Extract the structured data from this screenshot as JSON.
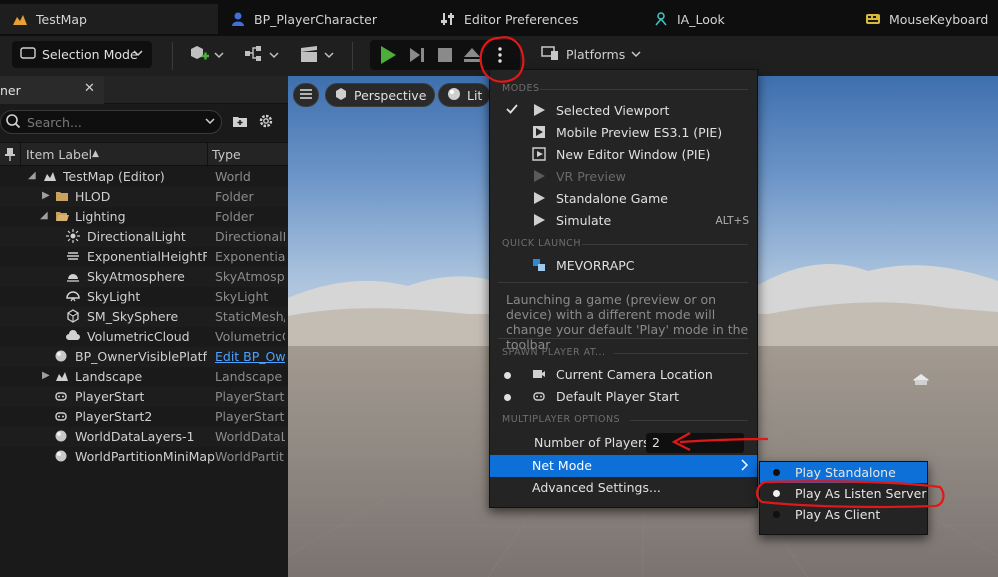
{
  "tabs": [
    {
      "label": "TestMap",
      "icon": "level-icon"
    },
    {
      "label": "BP_PlayerCharacter",
      "icon": "blueprint-icon"
    },
    {
      "label": "Editor Preferences",
      "icon": "sliders-icon"
    },
    {
      "label": "IA_Look",
      "icon": "input-action-icon"
    },
    {
      "label": "MouseKeyboard",
      "icon": "mapping-icon"
    }
  ],
  "toolbar": {
    "selection_mode": "Selection Mode",
    "platforms": "Platforms"
  },
  "outliner": {
    "title": "ner",
    "search_placeholder": "Search...",
    "col_label": "Item Label",
    "col_label_sort": "▲",
    "col_type": "Type",
    "rows": [
      {
        "label": "TestMap (Editor)",
        "type": "World"
      },
      {
        "label": "HLOD",
        "type": "Folder"
      },
      {
        "label": "Lighting",
        "type": "Folder"
      },
      {
        "label": "DirectionalLight",
        "type": "DirectionalL"
      },
      {
        "label": "ExponentialHeightFog",
        "type": "ExponentialI"
      },
      {
        "label": "SkyAtmosphere",
        "type": "SkyAtmospl"
      },
      {
        "label": "SkyLight",
        "type": "SkyLight"
      },
      {
        "label": "SM_SkySphere",
        "type": "StaticMesh/"
      },
      {
        "label": "VolumetricCloud",
        "type": "VolumetricC"
      },
      {
        "label": "BP_OwnerVisiblePlatfo",
        "type": "Edit BP_Ow"
      },
      {
        "label": "Landscape",
        "type": "Landscape"
      },
      {
        "label": "PlayerStart",
        "type": "PlayerStart"
      },
      {
        "label": "PlayerStart2",
        "type": "PlayerStart"
      },
      {
        "label": "WorldDataLayers-1",
        "type": "WorldDataL"
      },
      {
        "label": "WorldPartitionMiniMap",
        "type": "WorldPartiti"
      }
    ]
  },
  "viewport": {
    "perspective": "Perspective",
    "lit": "Lit"
  },
  "menu": {
    "sec_modes": "MODES",
    "modes": [
      {
        "label": "Selected Viewport",
        "checked": true
      },
      {
        "label": "Mobile Preview ES3.1 (PIE)"
      },
      {
        "label": "New Editor Window (PIE)"
      },
      {
        "label": "VR Preview",
        "disabled": true
      },
      {
        "label": "Standalone Game"
      },
      {
        "label": "Simulate",
        "shortcut": "ALT+S"
      }
    ],
    "sec_quick": "QUICK LAUNCH",
    "quick_device": "MEVORRAPC",
    "desc": "Launching a game (preview or on device) with a different mode will change your default 'Play' mode in the toolbar",
    "sec_spawn": "SPAWN PLAYER AT...",
    "spawn": [
      "Current Camera Location",
      "Default Player Start"
    ],
    "sec_multi": "MULTIPLAYER OPTIONS",
    "num_players_label": "Number of Players",
    "num_players_value": "2",
    "net_mode": "Net Mode",
    "advanced": "Advanced Settings..."
  },
  "submenu": {
    "items": [
      "Play Standalone",
      "Play As Listen Server",
      "Play As Client"
    ],
    "selected": "Play As Listen Server"
  },
  "colors": {
    "accent": "#0d6fd8",
    "play_green": "#4caf3a",
    "annotation_red": "#e01818"
  }
}
